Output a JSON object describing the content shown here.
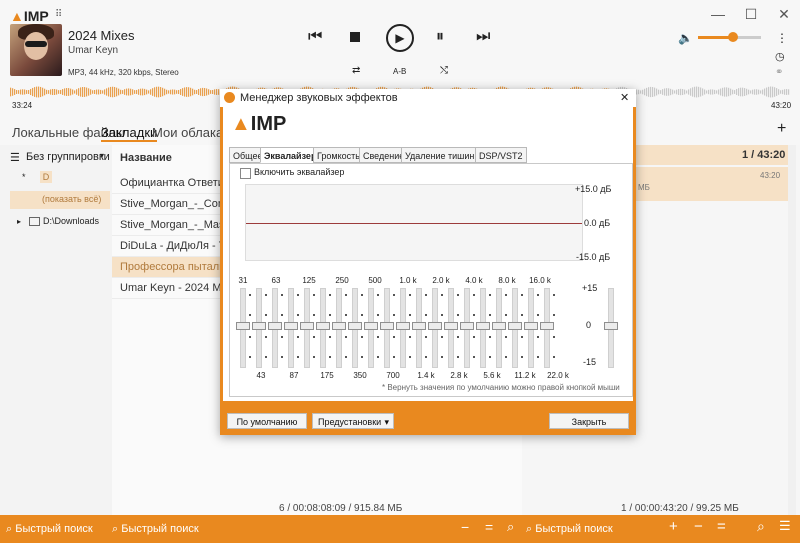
{
  "player": {
    "title": "2024 Mixes",
    "artist": "Umar Keyn",
    "format": "MP3, 44 kHz, 320 kbps, Stereo",
    "time_left": "33:24",
    "time_right": "43:20",
    "ab_label": "A-B",
    "volume_level": 0.55
  },
  "tabs": [
    "Локальные файлы",
    "Закладки",
    "Мои облака"
  ],
  "left": {
    "group_label": "Без группировки",
    "drive_letter": "D",
    "show_all": "(показать всё)",
    "folder": "D:\\Downloads"
  },
  "list": {
    "header": "Название",
    "rows": [
      "Официантка Ответила На Зво",
      "Stive_Morgan_-_Compilation_C",
      "Stive_Morgan_-_Masterminds_",
      "DiDuLa - ДиДюЛя - The Best (",
      "Профессора пытались унизи",
      "Umar Keyn - 2024 Mixes"
    ],
    "selected_index": 4
  },
  "right": {
    "count": "1 / 43:20",
    "duration": "43:20",
    "size": "МБ"
  },
  "status": {
    "center": "6 / 00:08:08:09 / 915.84 МБ",
    "right": "1 / 00:00:43:20 / 99.25 МБ"
  },
  "footer": {
    "search1": "Быстрый поиск",
    "search2": "Быстрый поиск",
    "search3": "Быстрый поиск"
  },
  "dialog": {
    "title": "Менеджер звуковых эффектов",
    "logo_text": "IMP",
    "tabs": [
      "Общее",
      "Эквалайзер",
      "Громкость",
      "Сведение",
      "Удаление тишины",
      "DSP/VST2"
    ],
    "active_tab": 1,
    "enable_label": "Включить эквалайзер",
    "db_top": "+15.0 дБ",
    "db_mid": "0.0 дБ",
    "db_bot": "-15.0 дБ",
    "bands_top": [
      "31",
      "63",
      "125",
      "250",
      "500",
      "1.0 k",
      "2.0 k",
      "4.0 k",
      "8.0 k",
      "16.0 k"
    ],
    "bands_bottom": [
      "43",
      "87",
      "175",
      "350",
      "700",
      "1.4 k",
      "2.8 k",
      "5.6 k",
      "11.2 k",
      "22.0 k"
    ],
    "scale_top": "+15",
    "scale_mid": "0",
    "scale_bot": "-15",
    "hint": "* Вернуть значения по умолчанию можно правой кнопкой мыши",
    "btn_default": "По умолчанию",
    "btn_presets": "Предустановки",
    "btn_close": "Закрыть"
  },
  "colors": {
    "accent": "#e9891f",
    "selection": "#f6e1c6"
  }
}
